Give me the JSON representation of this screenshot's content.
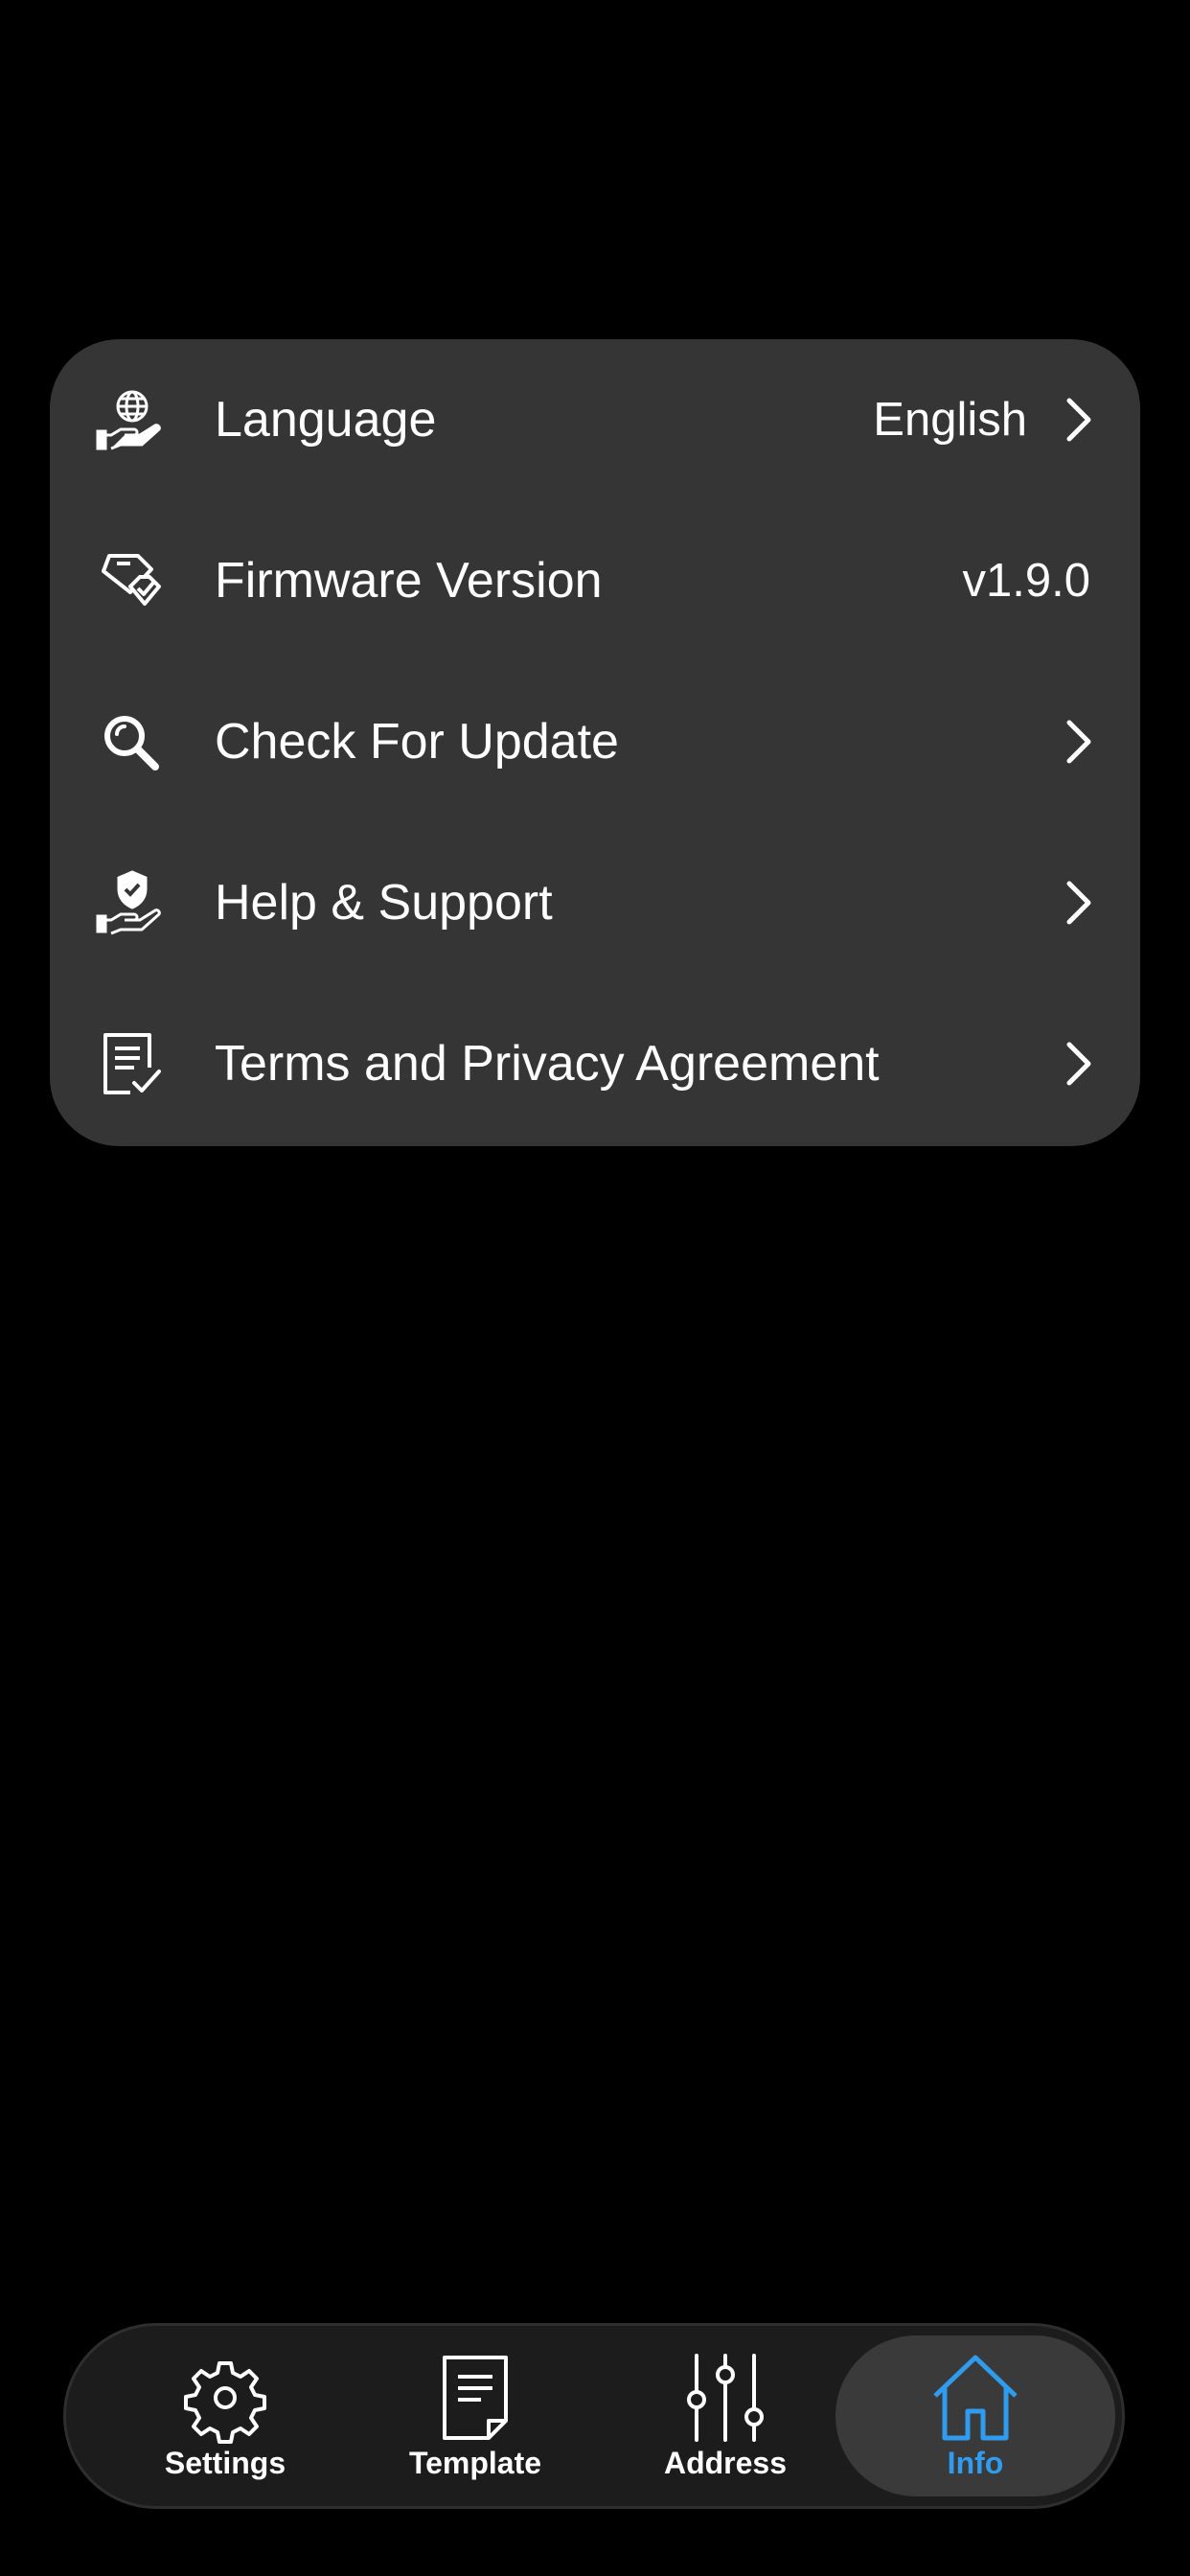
{
  "menu": {
    "items": [
      {
        "label": "Language",
        "value": "English",
        "icon": "globe-hand-icon",
        "has_chevron": true
      },
      {
        "label": "Firmware Version",
        "value": "v1.9.0",
        "icon": "firmware-badge-icon",
        "has_chevron": false
      },
      {
        "label": "Check For Update",
        "value": "",
        "icon": "search-icon",
        "has_chevron": true
      },
      {
        "label": "Help & Support",
        "value": "",
        "icon": "shield-hand-icon",
        "has_chevron": true
      },
      {
        "label": "Terms and Privacy Agreement",
        "value": "",
        "icon": "document-check-icon",
        "has_chevron": true
      }
    ]
  },
  "tabbar": {
    "tabs": [
      {
        "label": "Settings",
        "icon": "gear-icon",
        "active": false
      },
      {
        "label": "Template",
        "icon": "template-document-icon",
        "active": false
      },
      {
        "label": "Address",
        "icon": "sliders-icon",
        "active": false
      },
      {
        "label": "Info",
        "icon": "home-icon",
        "active": true
      }
    ]
  },
  "colors": {
    "background": "#000000",
    "card": "#353535",
    "text": "#ffffff",
    "accent": "#2f9cf0",
    "tabbar": "#1c1c1c",
    "tab_active_bg": "#3a3a3a"
  }
}
